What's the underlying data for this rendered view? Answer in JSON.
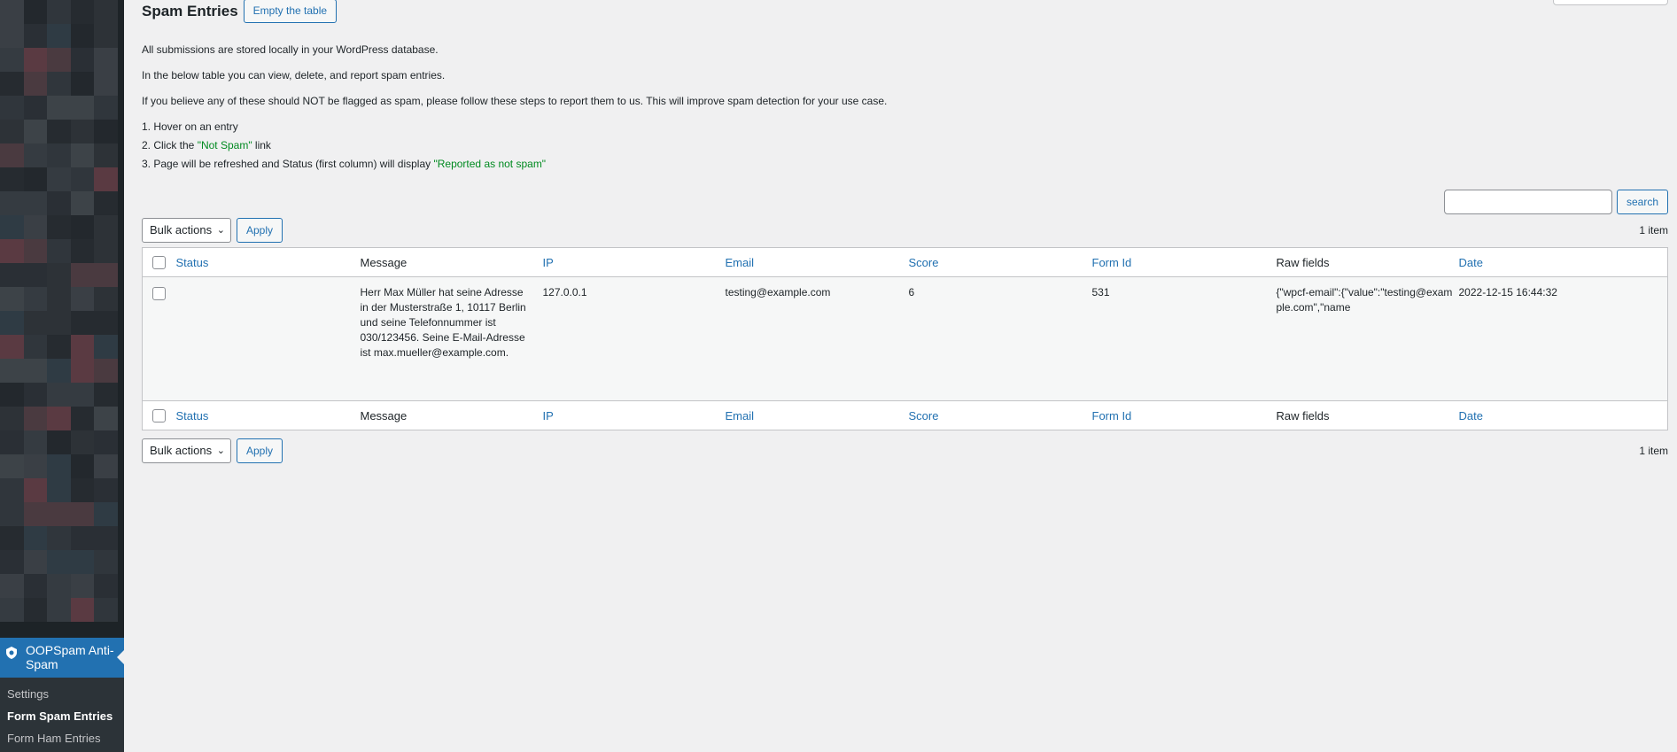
{
  "sidebar": {
    "plugin_title": "OOPSpam Anti-Spam",
    "submenu": [
      {
        "label": "Settings",
        "current": false
      },
      {
        "label": "Form Spam Entries",
        "current": true
      },
      {
        "label": "Form Ham Entries",
        "current": false
      }
    ]
  },
  "page": {
    "title": "Spam Entries",
    "empty_button": "Empty the table",
    "desc1": "All submissions are stored locally in your WordPress database.",
    "desc2": "In the below table you can view, delete, and report spam entries.",
    "desc3": "If you believe any of these should NOT be flagged as spam, please follow these steps to report them to us. This will improve spam detection for your use case.",
    "step1": "1. Hover on an entry",
    "step2_pre": "2. Click the ",
    "step2_highlight": "\"Not Spam\"",
    "step2_post": " link",
    "step3_pre": "3. Page will be refreshed and Status (first column) will display ",
    "step3_highlight": "\"Reported as not spam\""
  },
  "search": {
    "button": "search",
    "value": ""
  },
  "tablenav": {
    "bulk_actions": "Bulk actions",
    "apply": "Apply",
    "count": "1 item"
  },
  "table": {
    "columns": [
      "Status",
      "Message",
      "IP",
      "Email",
      "Score",
      "Form Id",
      "Raw fields",
      "Date"
    ],
    "rows": [
      {
        "status": "",
        "message": "Herr Max Müller hat seine Adresse in der Musterstraße 1, 10117 Berlin und seine Telefonnummer ist 030/123456. Seine E-Mail-Adresse ist max.mueller@example.com.",
        "ip": "127.0.0.1",
        "email": "testing@example.com",
        "score": "6",
        "form_id": "531",
        "raw_fields": "{\"wpcf-email\":{\"value\":\"testing@example.com\",\"name",
        "date": "2022-12-15 16:44:32"
      }
    ]
  },
  "colors": {
    "accent": "#2271b1",
    "sidebar": "#1d2327",
    "highlight_green": "#008a20"
  }
}
